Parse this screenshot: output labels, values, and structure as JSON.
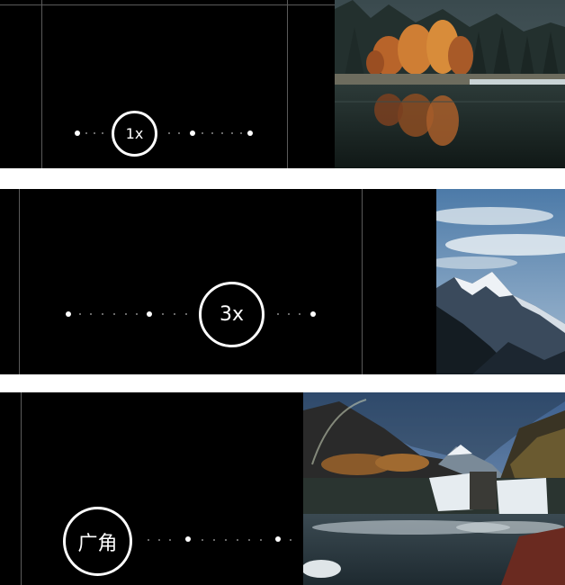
{
  "panels": [
    {
      "zoom_label": "1x",
      "photo": "autumn-lake-reflection-photo"
    },
    {
      "zoom_label": "3x",
      "photo": "snow-mountain-photo"
    },
    {
      "zoom_label": "广角",
      "photo": "waterfall-valley-photo"
    }
  ],
  "colors": {
    "background": "#000000",
    "separator": "#ffffff",
    "control": "#ffffff",
    "guide_line": "#5a5a5a"
  }
}
